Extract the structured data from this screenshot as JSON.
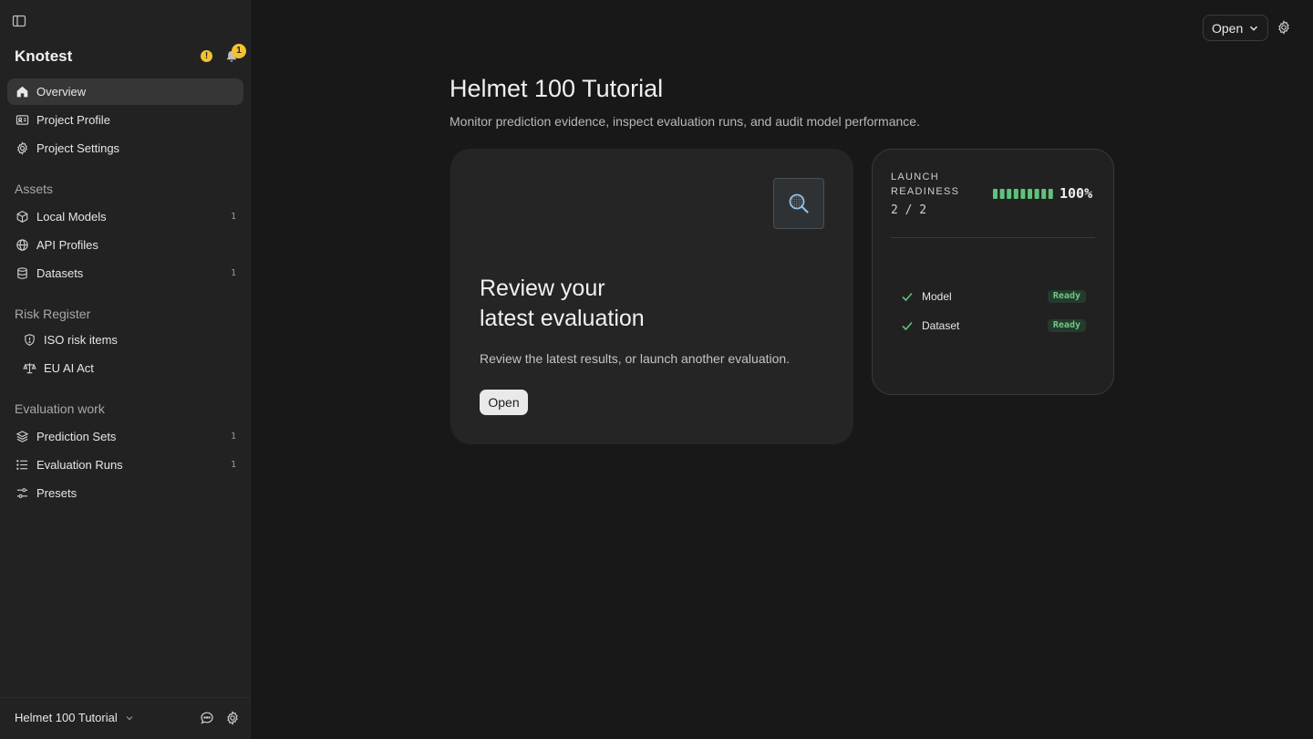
{
  "sidebar": {
    "brand": "Knotest",
    "warning_glyph": "!",
    "notification_count": "1",
    "nav_top": [
      {
        "label": "Overview",
        "icon": "home-icon",
        "active": true
      },
      {
        "label": "Project Profile",
        "icon": "id-card-icon"
      },
      {
        "label": "Project Settings",
        "icon": "gear-icon"
      }
    ],
    "assets": {
      "title": "Assets",
      "items": [
        {
          "label": "Local Models",
          "icon": "cube-icon",
          "count": "1"
        },
        {
          "label": "API Profiles",
          "icon": "globe-icon",
          "count": ""
        },
        {
          "label": "Datasets",
          "icon": "database-icon",
          "count": "1"
        }
      ]
    },
    "risk": {
      "title": "Risk Register",
      "items": [
        {
          "label": "ISO risk items",
          "icon": "shield-icon"
        },
        {
          "label": "EU AI Act",
          "icon": "scale-icon"
        }
      ]
    },
    "evaluation": {
      "title": "Evaluation work",
      "items": [
        {
          "label": "Prediction Sets",
          "icon": "layers-icon",
          "count": "1"
        },
        {
          "label": "Evaluation Runs",
          "icon": "list-icon",
          "count": "1"
        },
        {
          "label": "Presets",
          "icon": "sliders-icon",
          "count": ""
        }
      ]
    },
    "footer": {
      "project": "Helmet 100 Tutorial"
    }
  },
  "topbar": {
    "open_label": "Open"
  },
  "main": {
    "title": "Helmet 100 Tutorial",
    "subtitle": "Monitor prediction evidence, inspect evaluation runs, and audit model performance.",
    "review_card": {
      "heading_line1": "Review your",
      "heading_line2": "latest evaluation",
      "description": "Review the latest results, or launch another evaluation.",
      "button": "Open"
    },
    "readiness": {
      "label_line1": "LAUNCH",
      "label_line2": "READINESS",
      "count": "2 / 2",
      "percent": "100%",
      "progress": 1.0,
      "segments": 9,
      "items": [
        {
          "name": "Model",
          "status": "Ready"
        },
        {
          "name": "Dataset",
          "status": "Ready"
        }
      ]
    }
  },
  "colors": {
    "accent_green": "#5fc27a",
    "warning_yellow": "#f2c230",
    "background": "#181818",
    "sidebar": "#222222"
  }
}
